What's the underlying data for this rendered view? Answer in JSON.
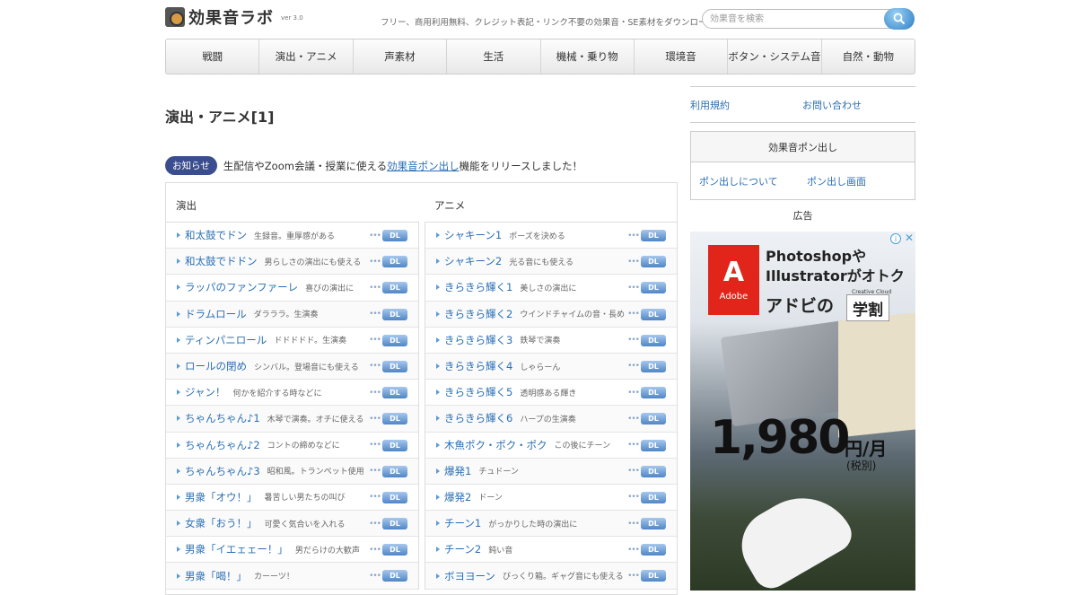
{
  "header": {
    "logo_text": "効果音ラボ",
    "logo_version": "ver 3.0",
    "tagline": "フリー、商用利用無料、クレジット表記・リンク不要の効果音・SE素材をダウンロード",
    "search_placeholder": "効果音を検索"
  },
  "nav": [
    "戦闘",
    "演出・アニメ",
    "声素材",
    "生活",
    "機械・乗り物",
    "環境音",
    "ボタン・システム音",
    "自然・動物"
  ],
  "page_title": "演出・アニメ[1]",
  "notice": {
    "badge": "お知らせ",
    "text_before": "生配信やZoom会議・授業に使える",
    "link": "効果音ポン出し",
    "text_after": "機能をリリースしました！"
  },
  "download_label": "DL",
  "columns": [
    {
      "heading": "演出",
      "items": [
        {
          "name": "和太鼓でドン",
          "desc": "生録音。重厚感がある"
        },
        {
          "name": "和太鼓でドドン",
          "desc": "男らしさの演出にも使える"
        },
        {
          "name": "ラッパのファンファーレ",
          "desc": "喜びの演出に"
        },
        {
          "name": "ドラムロール",
          "desc": "ダラララ。生演奏"
        },
        {
          "name": "ティンパニロール",
          "desc": "ドドドドド。生演奏"
        },
        {
          "name": "ロールの閉め",
          "desc": "シンバル。登場音にも使える"
        },
        {
          "name": "ジャン！",
          "desc": "何かを紹介する時などに"
        },
        {
          "name": "ちゃんちゃん♪1",
          "desc": "木琴で演奏。オチに使える"
        },
        {
          "name": "ちゃんちゃん♪2",
          "desc": "コントの締めなどに"
        },
        {
          "name": "ちゃんちゃん♪3",
          "desc": "昭和風。トランペット使用"
        },
        {
          "name": "男衆「オウ！」",
          "desc": "暑苦しい男たちの叫び"
        },
        {
          "name": "女衆「おう！」",
          "desc": "可愛く気合いを入れる"
        },
        {
          "name": "男衆「イエェェー！」",
          "desc": "男だらけの大歓声"
        },
        {
          "name": "男衆「喝！」",
          "desc": "カーーツ！"
        }
      ]
    },
    {
      "heading": "アニメ",
      "items": [
        {
          "name": "シャキーン1",
          "desc": "ポーズを決める"
        },
        {
          "name": "シャキーン2",
          "desc": "光る音にも使える"
        },
        {
          "name": "きらきら輝く1",
          "desc": "美しさの演出に"
        },
        {
          "name": "きらきら輝く2",
          "desc": "ウインドチャイムの音・長め"
        },
        {
          "name": "きらきら輝く3",
          "desc": "鉄琴で演奏"
        },
        {
          "name": "きらきら輝く4",
          "desc": "しゃらーん"
        },
        {
          "name": "きらきら輝く5",
          "desc": "透明感ある輝き"
        },
        {
          "name": "きらきら輝く6",
          "desc": "ハープの生演奏"
        },
        {
          "name": "木魚ポク・ポク・ポク",
          "desc": "この後にチーン"
        },
        {
          "name": "爆発1",
          "desc": "チュドーン"
        },
        {
          "name": "爆発2",
          "desc": "ドーン"
        },
        {
          "name": "チーン1",
          "desc": "がっかりした時の演出に"
        },
        {
          "name": "チーン2",
          "desc": "鈍い音"
        },
        {
          "name": "ボヨヨーン",
          "desc": "びっくり箱。ギャグ音にも使える"
        }
      ]
    }
  ],
  "sidebar": {
    "links": [
      "利用規約",
      "お問い合わせ"
    ],
    "pon_title": "効果音ポン出し",
    "pon_links": [
      "ポン出しについて",
      "ポン出し画面"
    ],
    "ad_label": "広告"
  },
  "ad": {
    "brand": "Adobe",
    "copy_line1": "Photoshopや",
    "copy_line2": "Illustratorがオトク",
    "copy_line3": "アドビの",
    "cc_label": "Creative Cloud",
    "gakuwari": "学割",
    "price": "1,980",
    "unit": "円/月",
    "tax": "(税別)"
  },
  "colors": {
    "link": "#2a6fb5",
    "badge": "#3a4d8f",
    "adobe_red": "#e1251b"
  }
}
